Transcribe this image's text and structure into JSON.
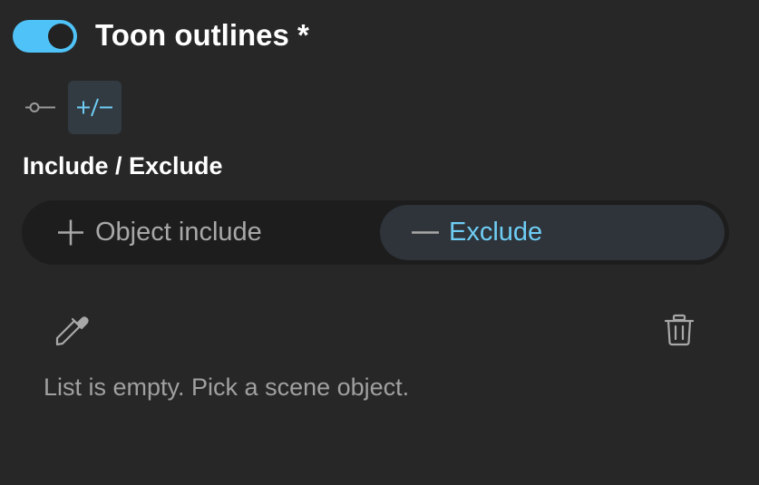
{
  "header": {
    "toggle_on": true,
    "title": "Toon outlines *"
  },
  "modes": {
    "single_icon": "connector-icon",
    "include_exclude_label": "+/−",
    "selected": "include-exclude"
  },
  "section": {
    "label": "Include / Exclude"
  },
  "segments": {
    "include_label": "Object include",
    "exclude_label": "Exclude",
    "selected": "exclude"
  },
  "list": {
    "picker_icon": "eyedropper-icon",
    "clear_icon": "trash-icon",
    "empty_message": "List is empty. Pick a scene object."
  },
  "colors": {
    "background": "#272727",
    "accent": "#4fc3f7",
    "accent_text": "#6fcdf5",
    "segment_track": "#1d1d1d",
    "segment_selected": "#2e3439"
  }
}
